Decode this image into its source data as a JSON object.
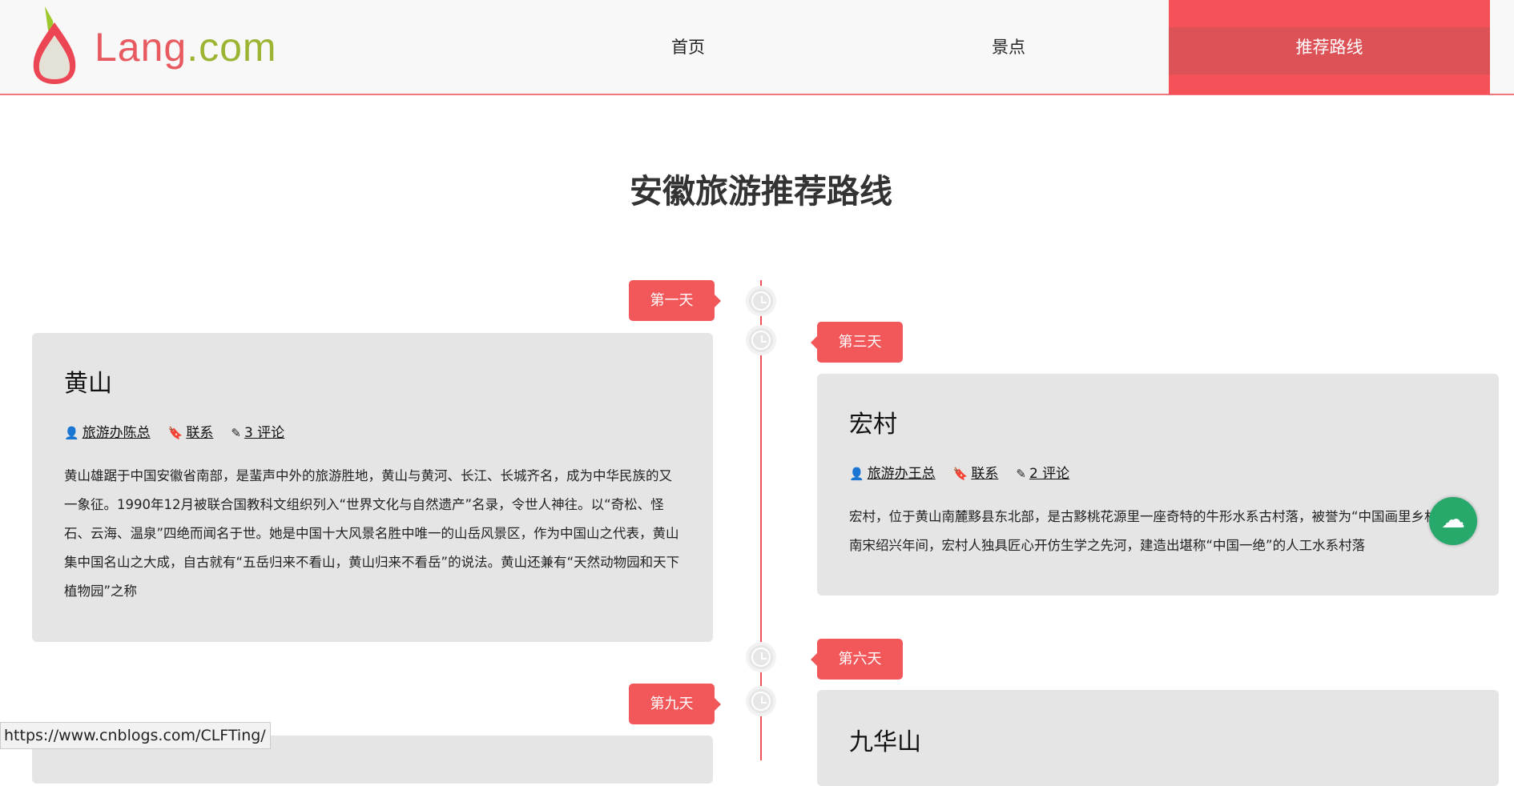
{
  "header": {
    "brand_part1": "Lang",
    "brand_part2": ".com",
    "nav": [
      {
        "label": "首页"
      },
      {
        "label": "景点"
      },
      {
        "label": "推荐路线",
        "active": true
      }
    ]
  },
  "page_title": "安徽旅游推荐路线",
  "colors": {
    "accent": "#f25759",
    "nav_active": "#f55159",
    "card_bg": "#e5e5e5",
    "cloud_button": "#27a96b"
  },
  "timeline": [
    {
      "day": "第一天",
      "title": "黄山",
      "author": "旅游办陈总",
      "contact": "联系",
      "comments": "3 评论",
      "body": "黄山雄踞于中国安徽省南部，是蜚声中外的旅游胜地，黄山与黄河、长江、长城齐名，成为中华民族的又一象征。1990年12月被联合国教科文组织列入“世界文化与自然遗产”名录，令世人神往。以“奇松、怪石、云海、温泉”四绝而闻名于世。她是中国十大风景名胜中唯一的山岳风景区，作为中国山之代表，黄山集中国名山之大成，自古就有“五岳归来不看山，黄山归来不看岳”的说法。黄山还兼有“天然动物园和天下植物园”之称"
    },
    {
      "day": "第三天",
      "title": "宏村",
      "author": "旅游办王总",
      "contact": "联系",
      "comments": "2 评论",
      "body": "宏村，位于黄山南麓黟县东北部，是古黟桃花源里一座奇特的牛形水系古村落，被誉为“中国画里乡村”。南宋绍兴年间，宏村人独具匠心开仿生学之先河，建造出堪称“中国一绝”的人工水系村落"
    },
    {
      "day": "第六天"
    },
    {
      "day": "第九天"
    },
    {
      "title": "九华山"
    }
  ],
  "icons": {
    "author": "user-icon",
    "contact": "bookmark-icon",
    "comments": "edit-icon",
    "timeline": "clock-icon",
    "floating": "cloud-download-icon"
  },
  "status_url": "https://www.cnblogs.com/CLFTing/"
}
